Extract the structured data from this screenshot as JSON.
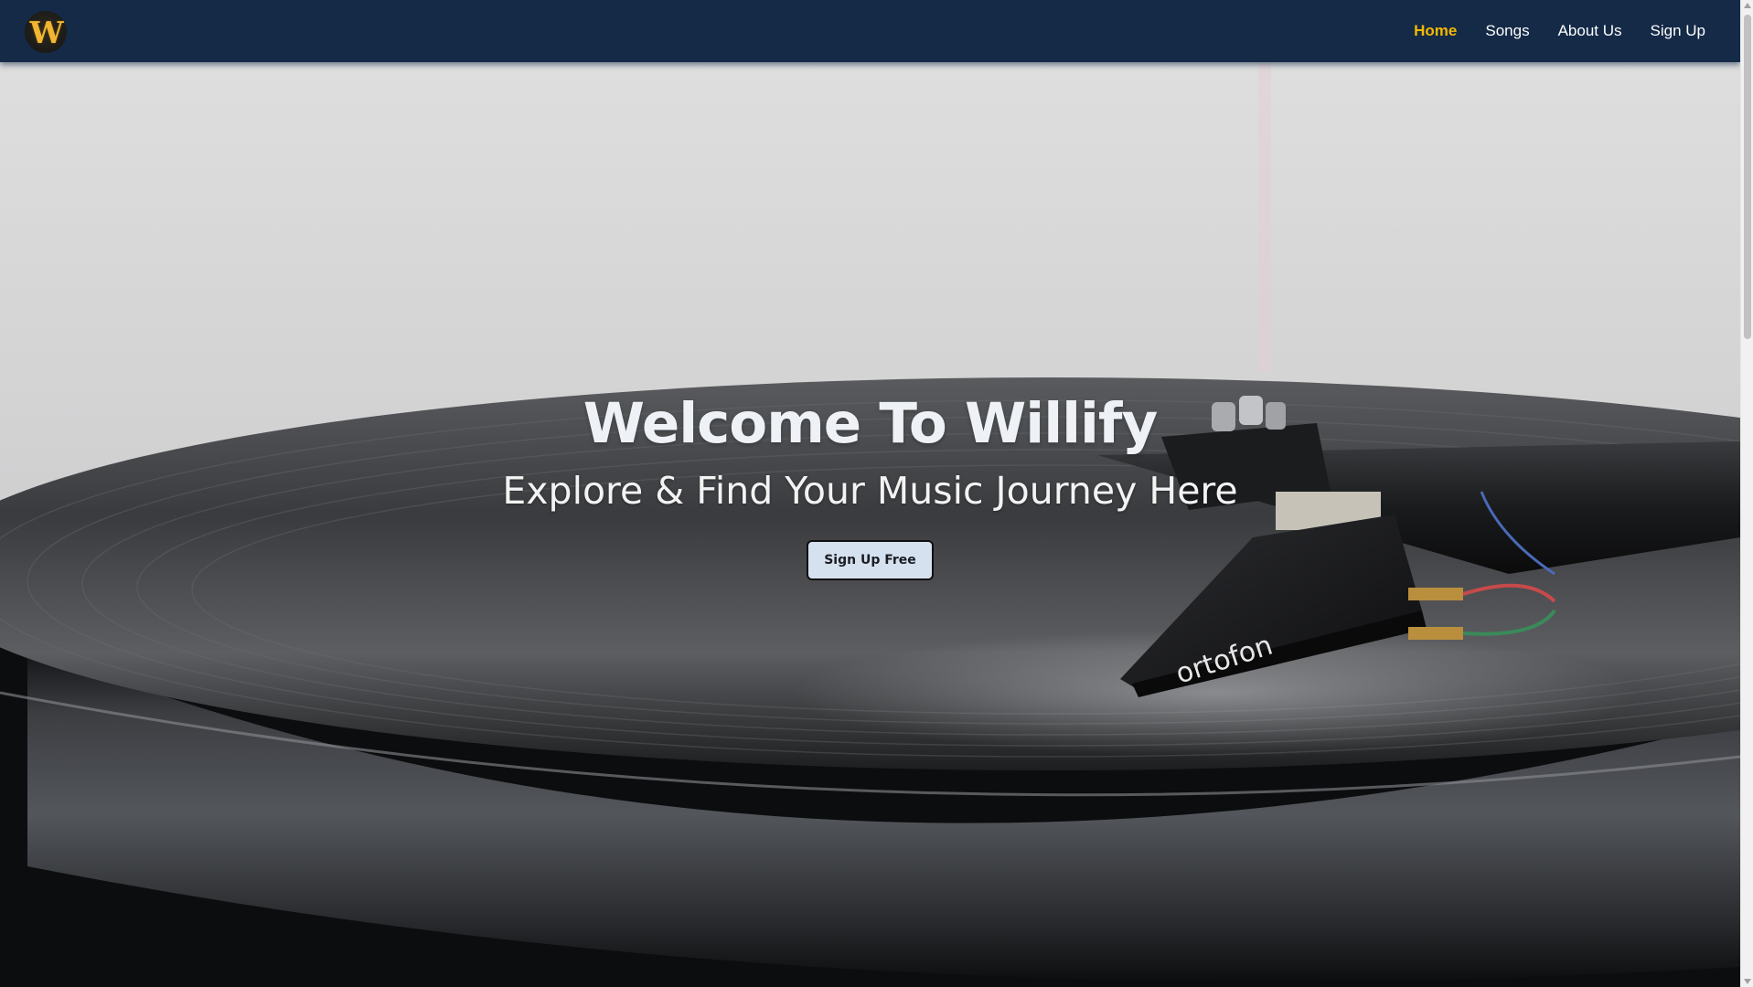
{
  "app": {
    "logo_text": "W",
    "logo_icon": "willify-logo-icon",
    "accent_color": "#f5b800",
    "navbar_color": "#142a47"
  },
  "nav": {
    "items": [
      {
        "label": "Home",
        "active": true
      },
      {
        "label": "Songs",
        "active": false
      },
      {
        "label": "About Us",
        "active": false
      },
      {
        "label": "Sign Up",
        "active": false
      }
    ]
  },
  "hero": {
    "title": "Welcome To Willify",
    "subtitle": "Explore & Find Your Music Journey Here",
    "cta_label": "Sign Up Free",
    "background_image": "turntable-vinyl-record-photo",
    "cartridge_brand": "ortofon"
  }
}
